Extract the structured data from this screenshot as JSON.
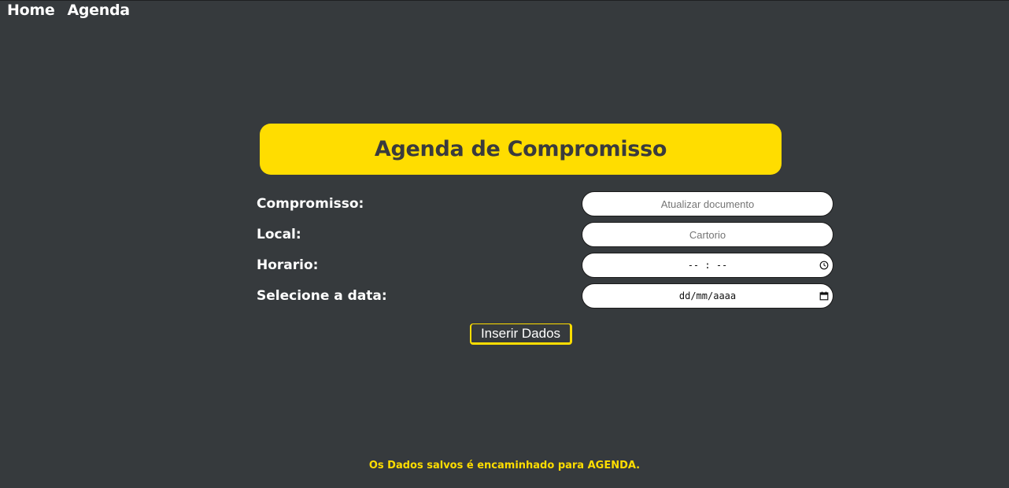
{
  "nav": {
    "items": [
      {
        "label": "Home"
      },
      {
        "label": "Agenda"
      }
    ]
  },
  "header": {
    "title": "Agenda de Compromisso"
  },
  "form": {
    "fields": [
      {
        "label": "Compromisso:",
        "placeholder": "Atualizar documento",
        "type": "text"
      },
      {
        "label": "Local:",
        "placeholder": "Cartorio",
        "type": "text"
      },
      {
        "label": "Horario:",
        "display": "-- : --",
        "type": "time",
        "icon": "clock-icon"
      },
      {
        "label": "Selecione a data:",
        "display": "dd/mm/aaaa",
        "type": "date",
        "icon": "calendar-icon"
      }
    ],
    "submit_label": "Inserir Dados"
  },
  "footer": {
    "note": "Os Dados salvos é encaminhado para AGENDA."
  },
  "colors": {
    "background": "#363a3d",
    "accent": "#ffdd00",
    "title_text": "#3a3b3d",
    "label_text": "#ffffff"
  }
}
